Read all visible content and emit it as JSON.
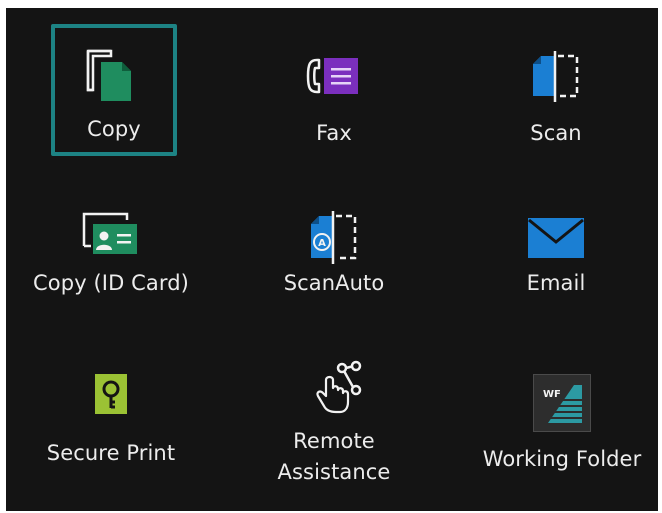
{
  "colors": {
    "background": "#141414",
    "selection_border": "#1d8384",
    "label": "#ececec",
    "copy_green": "#1f8d5f",
    "fax_purple": "#7b2fbe",
    "scan_blue": "#1b7fd3",
    "secure_lime": "#9bc234",
    "email_blue": "#1b7fd3"
  },
  "apps": [
    {
      "label": "Copy",
      "icon": "copy-icon",
      "selected": true
    },
    {
      "label": "Fax",
      "icon": "fax-icon",
      "selected": false
    },
    {
      "label": "Scan",
      "icon": "scan-icon",
      "selected": false
    },
    {
      "label": "Copy (ID Card)",
      "icon": "id-card-copy-icon",
      "selected": false
    },
    {
      "label": "ScanAuto",
      "icon": "scan-auto-icon",
      "selected": false
    },
    {
      "label": "Email",
      "icon": "email-icon",
      "selected": false
    },
    {
      "label": "Secure Print",
      "icon": "secure-print-icon",
      "selected": false
    },
    {
      "label_lines": [
        "Remote",
        "Assistance"
      ],
      "icon": "remote-assistance-icon",
      "selected": false
    },
    {
      "label": "Working Folder",
      "icon": "working-folder-icon",
      "icon_text": "WF",
      "selected": false
    }
  ]
}
